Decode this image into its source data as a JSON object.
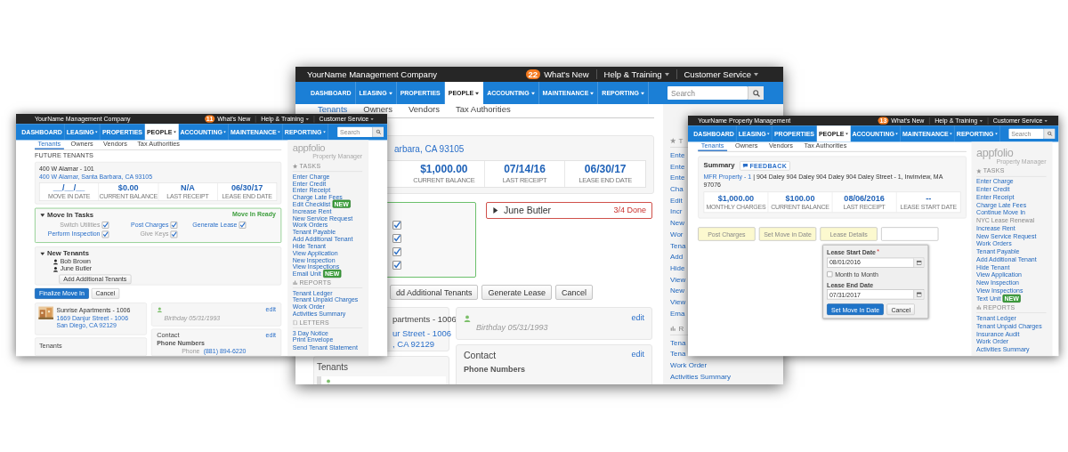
{
  "left_window": {
    "top_bar": {
      "company": "YourName Management Company",
      "badge": "11",
      "whats_new": "What's New",
      "menus": [
        "Help & Training",
        "Customer Service"
      ]
    },
    "nav": {
      "items": [
        {
          "label": "DASHBOARD",
          "dropdown": false,
          "selected": false
        },
        {
          "label": "LEASING",
          "dropdown": true,
          "selected": false
        },
        {
          "label": "PROPERTIES",
          "dropdown": false,
          "selected": false
        },
        {
          "label": "PEOPLE",
          "dropdown": true,
          "selected": true
        },
        {
          "label": "ACCOUNTING",
          "dropdown": true,
          "selected": false
        },
        {
          "label": "MAINTENANCE",
          "dropdown": true,
          "selected": false
        },
        {
          "label": "REPORTING",
          "dropdown": true,
          "selected": false
        }
      ],
      "search": {
        "placeholder": "Search"
      }
    },
    "tabs": [
      {
        "label": "Tenants",
        "selected": true
      },
      {
        "label": "Owners",
        "selected": false
      },
      {
        "label": "Vendors",
        "selected": false
      },
      {
        "label": "Tax Authorities",
        "selected": false
      }
    ],
    "heading": "FUTURE TENANTS",
    "property": {
      "unit": "400 W Alamar - 101",
      "address": "400 W Alamar, Santa Barbara, CA 93105"
    },
    "stats": [
      {
        "value": "__/__/__",
        "label": "MOVE IN DATE"
      },
      {
        "value": "$0.00",
        "label": "CURRENT BALANCE"
      },
      {
        "value": "N/A",
        "label": "LAST RECEIPT"
      },
      {
        "value": "06/30/17",
        "label": "LEASE END DATE"
      }
    ],
    "move_in_tasks": {
      "title": "Move In Tasks",
      "expanded": true,
      "status": "Move In Ready",
      "tasks": [
        {
          "label": "Switch Utilities",
          "disabled": true,
          "checked": true
        },
        {
          "label": "Post Charges",
          "disabled": false,
          "checked": true
        },
        {
          "label": "Generate Lease",
          "disabled": false,
          "checked": true
        },
        {
          "label": "Perform Inspection",
          "disabled": false,
          "checked": true
        },
        {
          "label": "Give Keys",
          "disabled": true,
          "checked": true
        }
      ]
    },
    "new_tenants": {
      "title": "New Tenants",
      "expanded": true,
      "tenants": [
        "Bob Brown",
        "June Butler"
      ],
      "add_button": "Add Additional Tenants"
    },
    "actions": [
      {
        "label": "Finalize Move In",
        "kind": "primary"
      },
      {
        "label": "Cancel",
        "kind": "default"
      }
    ],
    "unit_card": {
      "kind": "picture",
      "name": "Sunrise Apartments - 1006",
      "address_lines": [
        "1669 Danjur Street - 1006",
        "San Diego, CA 92129"
      ]
    },
    "tenant_card": {
      "edit": "edit",
      "birthday": "Birthday 05/31/1993"
    },
    "tenants_card": {
      "title": "Tenants"
    },
    "contact_card": {
      "title": "Contact",
      "edit": "edit",
      "subtitle": "Phone Numbers",
      "phone_label": "Phone",
      "phone": "(881) 894-6220"
    },
    "sidebar": {
      "logo": "appfolio",
      "tagline": "Property Manager",
      "sections": [
        {
          "kind": "tasks",
          "title": "TASKS",
          "items": [
            {
              "label": "Enter Charge"
            },
            {
              "label": "Enter Credit"
            },
            {
              "label": "Enter Receipt"
            },
            {
              "label": "Charge Late Fees"
            },
            {
              "label": "Edit Checklist",
              "badge": "NEW"
            },
            {
              "label": "Increase Rent"
            },
            {
              "label": "New Service Request"
            },
            {
              "label": "Work Orders"
            },
            {
              "label": "Tenant Payable"
            },
            {
              "label": "Add Additional Tenant"
            },
            {
              "label": "Hide Tenant"
            },
            {
              "label": "View Application"
            },
            {
              "label": "New Inspection"
            },
            {
              "label": "View Inspections"
            },
            {
              "label": "Email Unit",
              "badge": "NEW"
            }
          ]
        },
        {
          "kind": "reports",
          "title": "REPORTS",
          "items": [
            {
              "label": "Tenant Ledger"
            },
            {
              "label": "Tenant Unpaid Charges"
            },
            {
              "label": "Work Order"
            },
            {
              "label": "Activities Summary"
            }
          ]
        },
        {
          "kind": "letters",
          "title": "LETTERS",
          "items": [
            {
              "label": "3 Day Notice"
            },
            {
              "label": "Print Envelope"
            },
            {
              "label": "Send Tenant Statement"
            }
          ]
        }
      ]
    }
  },
  "center_window": {
    "top_bar": {
      "company": "YourName Management Company",
      "badge": "22",
      "whats_new": "What's New",
      "menus": [
        "Help & Training",
        "Customer Service"
      ]
    },
    "nav": {
      "items": [
        {
          "label": "DASHBOARD",
          "dropdown": false,
          "selected": false
        },
        {
          "label": "LEASING",
          "dropdown": true,
          "selected": false
        },
        {
          "label": "PROPERTIES",
          "dropdown": false,
          "selected": false
        },
        {
          "label": "PEOPLE",
          "dropdown": true,
          "selected": true
        },
        {
          "label": "ACCOUNTING",
          "dropdown": true,
          "selected": false
        },
        {
          "label": "MAINTENANCE",
          "dropdown": true,
          "selected": false
        },
        {
          "label": "REPORTING",
          "dropdown": true,
          "selected": false
        }
      ],
      "search": {
        "placeholder": "Search"
      }
    },
    "tabs": [
      {
        "label": "Tenants",
        "selected": true
      },
      {
        "label": "Owners",
        "selected": false
      },
      {
        "label": "Vendors",
        "selected": false
      },
      {
        "label": "Tax Authorities",
        "selected": false
      }
    ],
    "address_fragment": "arbara, CA 93105",
    "stats": [
      {
        "value": "$1,000.00",
        "label": "CURRENT BALANCE"
      },
      {
        "value": "07/14/16",
        "label": "LAST RECEIPT"
      },
      {
        "value": "06/30/17",
        "label": "LEASE END DATE"
      }
    ],
    "task_checks": [
      {
        "checked": true
      },
      {
        "checked": true
      },
      {
        "checked": true
      },
      {
        "checked": true
      }
    ],
    "tenant_progress": {
      "name": "June Butler",
      "expanded": false,
      "status": "3/4 Done"
    },
    "actions": [
      {
        "label": "dd Additional Tenants"
      },
      {
        "label": "Generate Lease"
      },
      {
        "label": "Cancel"
      }
    ],
    "unit_card": {
      "name": "partments - 1006",
      "address_lines": [
        "ur Street - 1006",
        ", CA 92129"
      ]
    },
    "tenants_card": {
      "title": "Tenants"
    },
    "tenant_card": {
      "edit": "edit",
      "birthday": "Birthday 05/31/1993"
    },
    "contact_card": {
      "title": "Contact",
      "edit": "edit",
      "subtitle": "Phone Numbers"
    },
    "sidebar": {
      "sections": [
        {
          "kind": "tasks",
          "title": "T",
          "items": [
            {
              "label": "Ente"
            },
            {
              "label": "Ente"
            },
            {
              "label": "Ente"
            },
            {
              "label": "Cha"
            },
            {
              "label": "Edit"
            },
            {
              "label": "Incr"
            },
            {
              "label": "New"
            },
            {
              "label": "Wor"
            },
            {
              "label": "Tena"
            },
            {
              "label": "Add"
            },
            {
              "label": "Hide"
            },
            {
              "label": "View"
            },
            {
              "label": "New"
            },
            {
              "label": "View"
            },
            {
              "label": "Ema"
            }
          ]
        },
        {
          "kind": "reports",
          "title": "R",
          "items": [
            {
              "label": "Tena"
            },
            {
              "label": "Tena"
            },
            {
              "label": "Work Order"
            },
            {
              "label": "Activities Summary"
            }
          ]
        }
      ]
    }
  },
  "right_window": {
    "top_bar": {
      "company": "YourName Property Management",
      "badge": "13",
      "whats_new": "What's New",
      "menus": [
        "Help & Training",
        "Customer Service"
      ]
    },
    "nav": {
      "items": [
        {
          "label": "DASHBOARD",
          "dropdown": false,
          "selected": false
        },
        {
          "label": "LEASING",
          "dropdown": true,
          "selected": false
        },
        {
          "label": "PROPERTIES",
          "dropdown": false,
          "selected": false
        },
        {
          "label": "PEOPLE",
          "dropdown": true,
          "selected": true
        },
        {
          "label": "ACCOUNTING",
          "dropdown": true,
          "selected": false
        },
        {
          "label": "MAINTENANCE",
          "dropdown": true,
          "selected": false
        },
        {
          "label": "REPORTING",
          "dropdown": true,
          "selected": false
        }
      ],
      "search": {
        "placeholder": "Search"
      }
    },
    "tabs": [
      {
        "label": "Tenants",
        "selected": true
      },
      {
        "label": "Owners",
        "selected": false
      },
      {
        "label": "Vendors",
        "selected": false
      },
      {
        "label": "Tax Authorities",
        "selected": false
      }
    ],
    "summary": {
      "title": "Summary",
      "feedback": "FEEDBACK",
      "property_link": "MFR Property - 1",
      "address": "| 904 Daley 904 Daley 904 Daley 904 Daley Street - 1, Irwinview, MA 97076"
    },
    "stats": [
      {
        "value": "$1,000.00",
        "label": "MONTHLY CHARGES"
      },
      {
        "value": "$100.00",
        "label": "CURRENT BALANCE"
      },
      {
        "value": "08/06/2016",
        "label": "LAST RECEIPT"
      },
      {
        "value": "--",
        "label": "LEASE START DATE"
      }
    ],
    "steps": [
      {
        "label": "Post Charges",
        "highlighted": true
      },
      {
        "label": "Set Move in Date",
        "highlighted": true
      },
      {
        "label": "Lease Details",
        "highlighted": true
      },
      {
        "highlighted": false
      }
    ],
    "move_in_popover": {
      "start_label": "Lease Start Date",
      "required_mark": "*",
      "start_value": "08/01/2016",
      "month_to_month": {
        "label": "Month to Month",
        "checked": false
      },
      "end_label": "Lease End Date",
      "end_value": "07/31/2017",
      "buttons": [
        {
          "label": "Set Move In Date",
          "kind": "primary"
        },
        {
          "label": "Cancel",
          "kind": "default"
        }
      ]
    },
    "sidebar": {
      "logo": "appfolio",
      "tagline": "Property Manager",
      "sections": [
        {
          "kind": "tasks",
          "title": "TASKS",
          "items": [
            {
              "label": "Enter Charge",
              "disabled": false
            },
            {
              "label": "Enter Credit",
              "disabled": false
            },
            {
              "label": "Enter Receipt",
              "disabled": false
            },
            {
              "label": "Charge Late Fees",
              "disabled": false
            },
            {
              "label": "Continue Move In",
              "disabled": false
            },
            {
              "label": "NYC Lease Renewal",
              "disabled": true
            },
            {
              "label": "Increase Rent",
              "disabled": false
            },
            {
              "label": "New Service Request",
              "disabled": false
            },
            {
              "label": "Work Orders",
              "disabled": false
            },
            {
              "label": "Tenant Payable",
              "disabled": false
            },
            {
              "label": "Add Additional Tenant",
              "disabled": false
            },
            {
              "label": "Hide Tenant",
              "disabled": false
            },
            {
              "label": "View Application",
              "disabled": false
            },
            {
              "label": "New Inspection",
              "disabled": false
            },
            {
              "label": "View Inspections",
              "disabled": false
            },
            {
              "label": "Text Unit",
              "disabled": false,
              "badge": "NEW"
            }
          ]
        },
        {
          "kind": "reports",
          "title": "REPORTS",
          "items": [
            {
              "label": "Tenant Ledger",
              "disabled": false
            },
            {
              "label": "Tenant Unpaid Charges",
              "disabled": false
            },
            {
              "label": "Insurance Audit",
              "disabled": false
            },
            {
              "label": "Work Order",
              "disabled": false
            },
            {
              "label": "Activities Summary",
              "disabled": false
            }
          ]
        }
      ]
    }
  }
}
